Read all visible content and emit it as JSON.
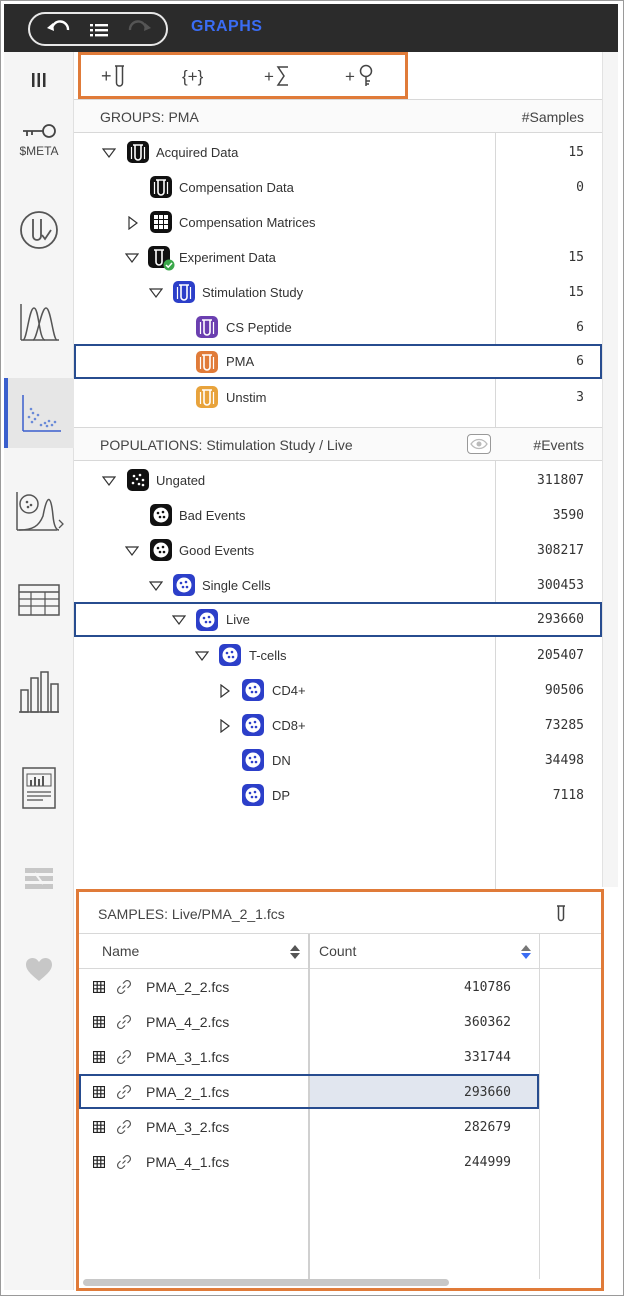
{
  "app": {
    "title": "GRAPHS"
  },
  "sidebar": {
    "items": [
      {
        "name": "columns",
        "icon": "columns-icon"
      },
      {
        "name": "meta",
        "icon": "key-icon",
        "label": "$META"
      },
      {
        "name": "tube-check",
        "icon": "tube-check-icon"
      },
      {
        "name": "histogram-overlay",
        "icon": "histogram-icon"
      },
      {
        "name": "dot-plot",
        "icon": "scatter-plot-icon"
      },
      {
        "name": "gate-histogram",
        "icon": "gate-histogram-icon"
      },
      {
        "name": "table",
        "icon": "table-icon"
      },
      {
        "name": "bar-chart",
        "icon": "bar-chart-icon"
      },
      {
        "name": "report",
        "icon": "report-icon"
      },
      {
        "name": "workflow",
        "icon": "workflow-icon"
      },
      {
        "name": "favorite",
        "icon": "heart-icon"
      }
    ]
  },
  "toolbar": {
    "buttons": [
      {
        "label": "+",
        "icon": "add-tube-icon"
      },
      {
        "label": "{+}",
        "icon": "add-group-icon"
      },
      {
        "label": "+∑",
        "icon": "add-statistic-icon"
      },
      {
        "label": "+",
        "icon": "add-keyword-icon"
      }
    ]
  },
  "groups": {
    "title": "GROUPS: PMA",
    "count_header": "#Samples",
    "rows": [
      {
        "label": "Acquired Data",
        "count": "15"
      },
      {
        "label": "Compensation Data",
        "count": "0"
      },
      {
        "label": "Compensation Matrices",
        "count": ""
      },
      {
        "label": "Experiment Data",
        "count": "15"
      },
      {
        "label": "Stimulation Study",
        "count": "15"
      },
      {
        "label": "CS Peptide",
        "count": "6"
      },
      {
        "label": "PMA",
        "count": "6"
      },
      {
        "label": "Unstim",
        "count": "3"
      }
    ]
  },
  "populations": {
    "title": "POPULATIONS: Stimulation Study / Live",
    "count_header": "#Events",
    "rows": [
      {
        "label": "Ungated",
        "count": "311807"
      },
      {
        "label": "Bad Events",
        "count": "3590"
      },
      {
        "label": "Good Events",
        "count": "308217"
      },
      {
        "label": "Single Cells",
        "count": "300453"
      },
      {
        "label": "Live",
        "count": "293660"
      },
      {
        "label": "T-cells",
        "count": "205407"
      },
      {
        "label": "CD4+",
        "count": "90506"
      },
      {
        "label": "CD8+",
        "count": "73285"
      },
      {
        "label": "DN",
        "count": "34498"
      },
      {
        "label": "DP",
        "count": "7118"
      }
    ]
  },
  "samples": {
    "title": "SAMPLES: Live/PMA_2_1.fcs",
    "columns": {
      "name": "Name",
      "count": "Count"
    },
    "rows": [
      {
        "name": "PMA_2_2.fcs",
        "count": "410786"
      },
      {
        "name": "PMA_4_2.fcs",
        "count": "360362"
      },
      {
        "name": "PMA_3_1.fcs",
        "count": "331744"
      },
      {
        "name": "PMA_2_1.fcs",
        "count": "293660"
      },
      {
        "name": "PMA_3_2.fcs",
        "count": "282679"
      },
      {
        "name": "PMA_4_1.fcs",
        "count": "244999"
      }
    ]
  },
  "colors": {
    "accent_blue": "#3a6cf4",
    "selection_border": "#274c8f",
    "highlight_orange": "#e07b39",
    "tube_purple": "#6b3fb0",
    "tube_orange": "#e07b39",
    "tube_yellow": "#e8a33c",
    "node_blue": "#2c3fc9",
    "check_green": "#3aa84a"
  }
}
